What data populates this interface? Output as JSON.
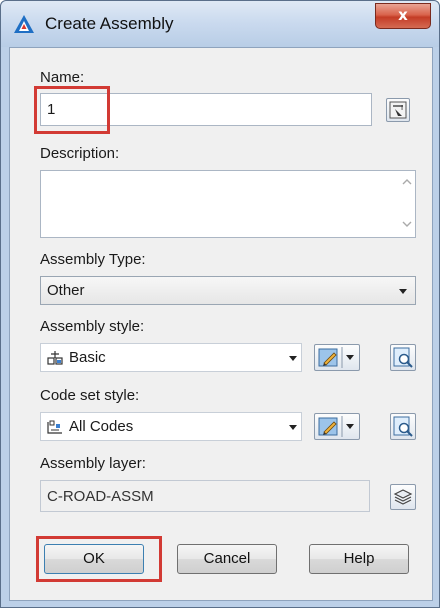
{
  "window": {
    "title": "Create Assembly",
    "close_glyph": "x"
  },
  "fields": {
    "name_label": "Name:",
    "name_value": "1",
    "description_label": "Description:",
    "description_value": "",
    "assembly_type_label": "Assembly Type:",
    "assembly_type_value": "Other",
    "assembly_style_label": "Assembly style:",
    "assembly_style_value": "Basic",
    "code_set_style_label": "Code set style:",
    "code_set_style_value": "All Codes",
    "assembly_layer_label": "Assembly layer:",
    "assembly_layer_value": "C-ROAD-ASSM"
  },
  "buttons": {
    "ok": "OK",
    "cancel": "Cancel",
    "help": "Help"
  },
  "colors": {
    "highlight": "#d23a34",
    "title_bar": "#c9d9ee",
    "close_button": "#c43c26"
  },
  "icons": [
    "autocad-civil-icon",
    "close-icon",
    "name-template-icon",
    "scroll-up-icon",
    "scroll-down-icon",
    "dropdown-arrow-icon",
    "assembly-style-icon",
    "edit-style-icon",
    "style-details-icon",
    "code-set-icon",
    "layer-stack-icon"
  ]
}
